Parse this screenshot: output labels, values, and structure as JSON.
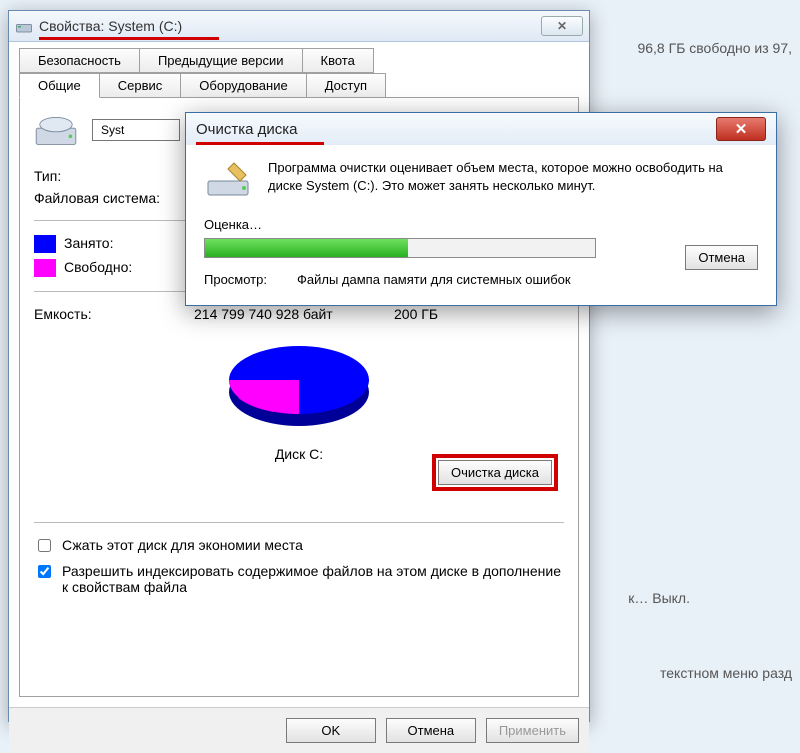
{
  "bg": {
    "free_space": "96,8 ГБ свободно из 97,",
    "status": "к… Выкл.",
    "context_menu": "текстном меню разд"
  },
  "properties": {
    "title": "Свойства: System (C:)",
    "tabs_row1": [
      "Безопасность",
      "Предыдущие версии",
      "Квота"
    ],
    "tabs_row2": [
      "Общие",
      "Сервис",
      "Оборудование",
      "Доступ"
    ],
    "drive_name": "Syst",
    "type_label": "Тип:",
    "fs_label": "Файловая система:",
    "used_label": "Занято:",
    "free_label": "Свободно:",
    "capacity_label": "Емкость:",
    "capacity_bytes": "214 799 740 928 байт",
    "capacity_gb": "200 ГБ",
    "disk_label": "Диск C:",
    "cleanup_btn": "Очистка диска",
    "compress_chk": "Сжать этот диск для экономии места",
    "index_chk": "Разрешить индексировать содержимое файлов на этом диске в дополнение к свойствам файла",
    "ok": "OK",
    "cancel": "Отмена",
    "apply": "Применить"
  },
  "cleanup": {
    "title": "Очистка диска",
    "description": "Программа очистки оценивает объем места, которое можно освободить на диске System (C:). Это может занять несколько минут.",
    "progress_label": "Оценка…",
    "view_label": "Просмотр:",
    "view_value": "Файлы дампа памяти для системных ошибок",
    "cancel": "Отмена"
  },
  "chart_data": {
    "type": "pie",
    "title": "Диск C:",
    "series": [
      {
        "name": "Занято",
        "value": 70,
        "color": "#0000ff"
      },
      {
        "name": "Свободно",
        "value": 30,
        "color": "#ff00ff"
      }
    ],
    "total_bytes": 214799740928,
    "total_label": "200 ГБ"
  }
}
